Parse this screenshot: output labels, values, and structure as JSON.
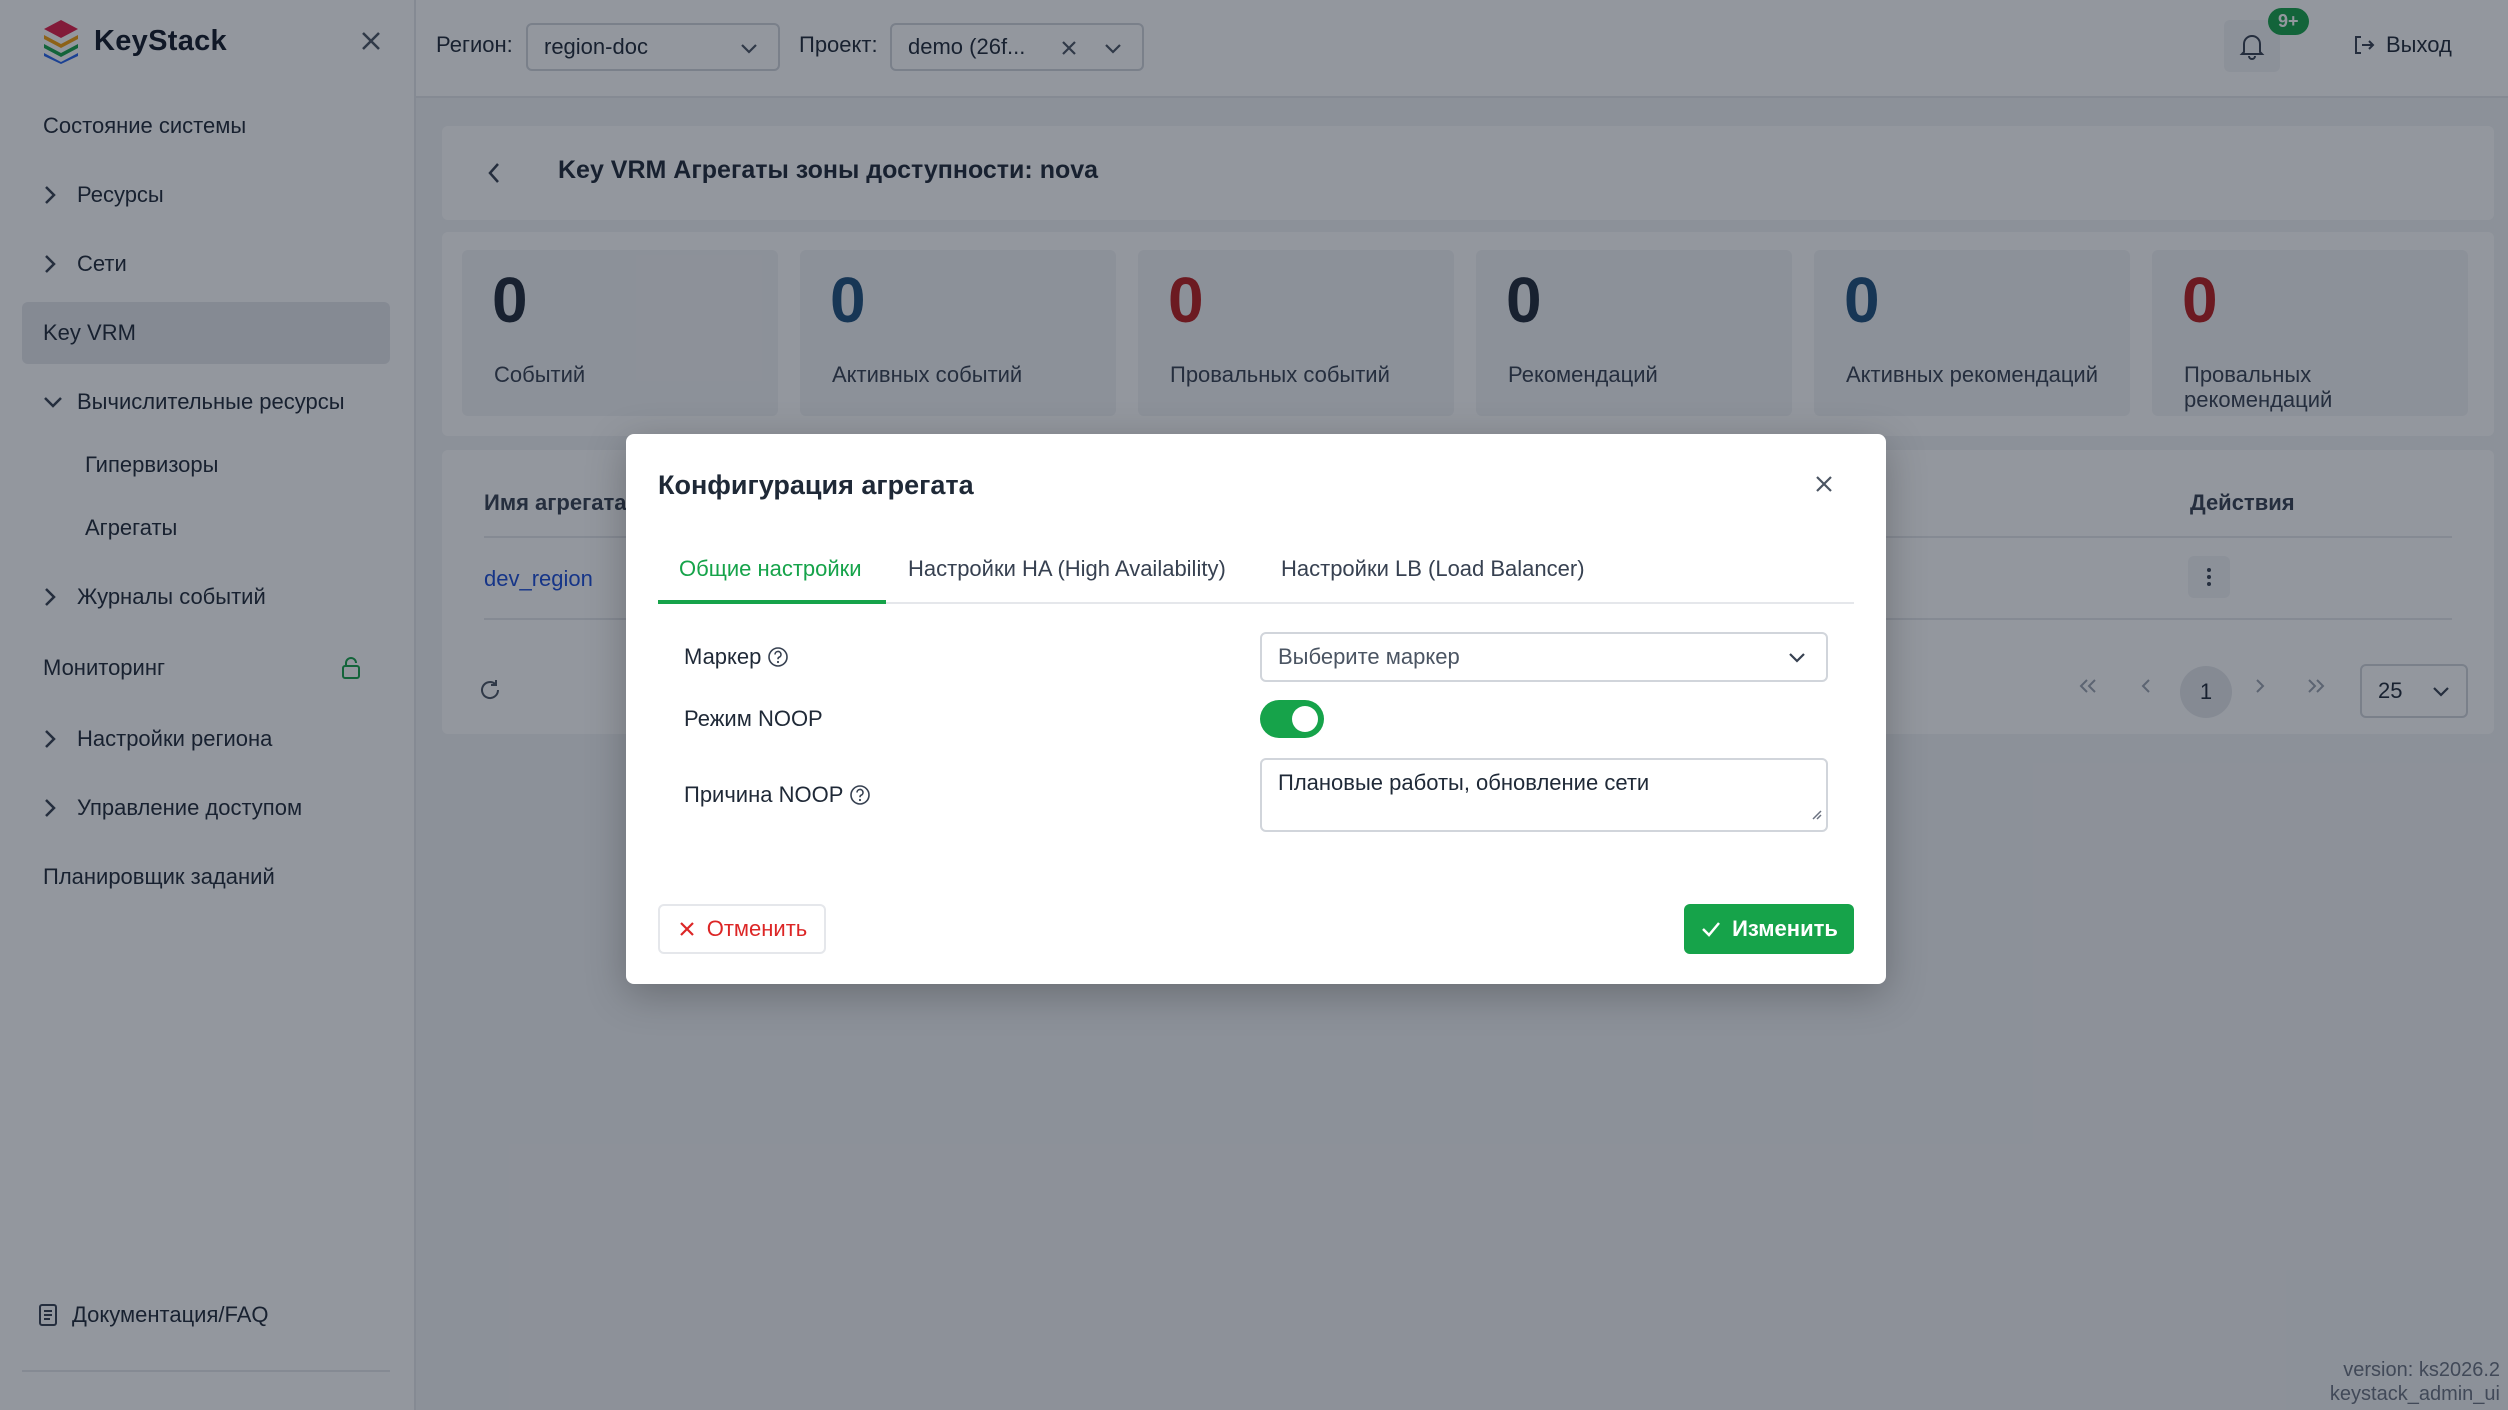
{
  "app": {
    "name": "KeyStack"
  },
  "sidebar": {
    "items": [
      {
        "label": "Состояние системы"
      },
      {
        "label": "Ресурсы"
      },
      {
        "label": "Сети"
      },
      {
        "label": "Key VRM"
      },
      {
        "label": "Вычислительные ресурсы"
      },
      {
        "label": "Гипервизоры"
      },
      {
        "label": "Агрегаты"
      },
      {
        "label": "Журналы событий"
      },
      {
        "label": "Мониторинг"
      },
      {
        "label": "Настройки региона"
      },
      {
        "label": "Управление доступом"
      },
      {
        "label": "Планировщик заданий"
      }
    ],
    "docs_label": "Документация/FAQ"
  },
  "topbar": {
    "region_label": "Регион:",
    "region_value": "region-doc",
    "project_label": "Проект:",
    "project_value": "demo (26f...",
    "notifications_badge": "9+",
    "logout_label": "Выход"
  },
  "page": {
    "title": "Key VRM Агрегаты зоны доступности: nova"
  },
  "stats": [
    {
      "value": "0",
      "label": "Событий",
      "color": "#1f2937"
    },
    {
      "value": "0",
      "label": "Активных событий",
      "color": "#1e4f7a"
    },
    {
      "value": "0",
      "label": "Провальных событий",
      "color": "#b91c1c"
    },
    {
      "value": "0",
      "label": "Рекомендаций",
      "color": "#1f2937"
    },
    {
      "value": "0",
      "label": "Активных рекомендаций",
      "color": "#1e4f7a"
    },
    {
      "value": "0",
      "label": "Провальных рекомендаций",
      "color": "#b91c1c"
    }
  ],
  "table": {
    "col_name": "Имя агрегата",
    "col_actions": "Действия",
    "rows": [
      {
        "name": "dev_region"
      }
    ]
  },
  "pagination": {
    "current_page": "1",
    "page_size": "25"
  },
  "version": {
    "line1": "version: ks2026.2",
    "line2": "keystack_admin_ui"
  },
  "modal": {
    "title": "Конфигурация агрегата",
    "tabs": [
      {
        "label": "Общие настройки"
      },
      {
        "label": "Настройки HA (High Availability)"
      },
      {
        "label": "Настройки LB (Load Balancer)"
      }
    ],
    "marker_label": "Маркер",
    "marker_placeholder": "Выберите маркер",
    "noop_mode_label": "Режим NOOP",
    "noop_enabled": true,
    "noop_reason_label": "Причина NOOP",
    "noop_reason_value": "Плановые работы, обновление сети",
    "cancel_label": "Отменить",
    "submit_label": "Изменить"
  },
  "colors": {
    "accent": "#16a34a",
    "danger": "#dc2626",
    "link": "#1d4ed8"
  }
}
